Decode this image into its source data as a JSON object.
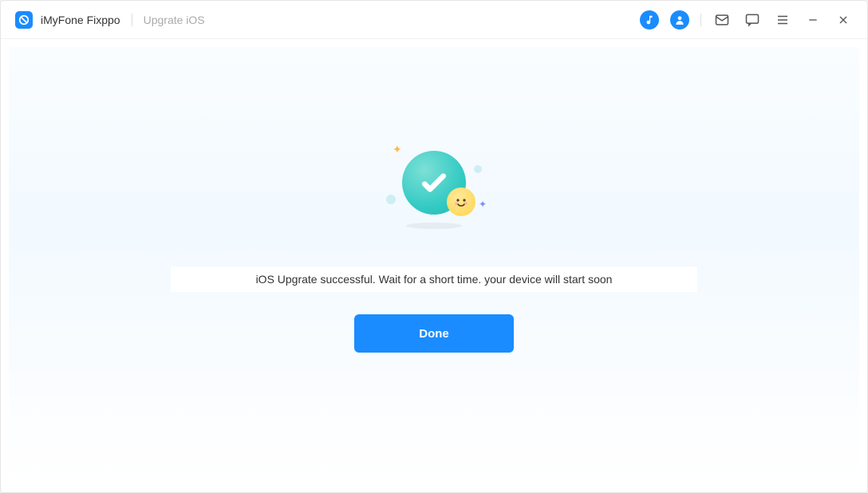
{
  "header": {
    "app_title": "iMyFone Fixppo",
    "breadcrumb": "Upgrate iOS"
  },
  "main": {
    "status_message": "iOS Upgrate successful. Wait for a short time. your device will start soon",
    "done_label": "Done"
  }
}
